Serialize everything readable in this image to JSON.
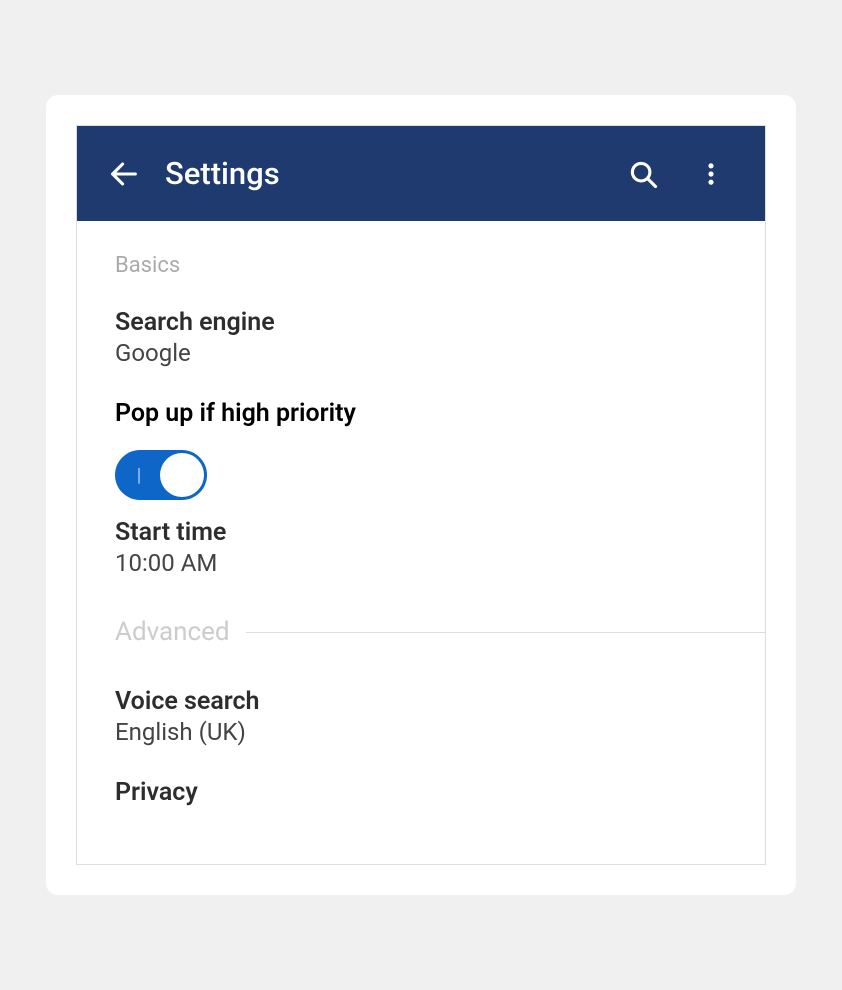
{
  "toolbar": {
    "title": "Settings"
  },
  "sections": {
    "basics": {
      "label": "Basics",
      "search_engine": {
        "title": "Search engine",
        "value": "Google"
      },
      "popup": {
        "title": "Pop up if high priority",
        "enabled": true
      },
      "start_time": {
        "title": "Start time",
        "value": "10:00 AM"
      }
    },
    "advanced": {
      "label": "Advanced",
      "voice_search": {
        "title": "Voice search",
        "value": "English (UK)"
      },
      "privacy": {
        "title": "Privacy"
      }
    }
  }
}
